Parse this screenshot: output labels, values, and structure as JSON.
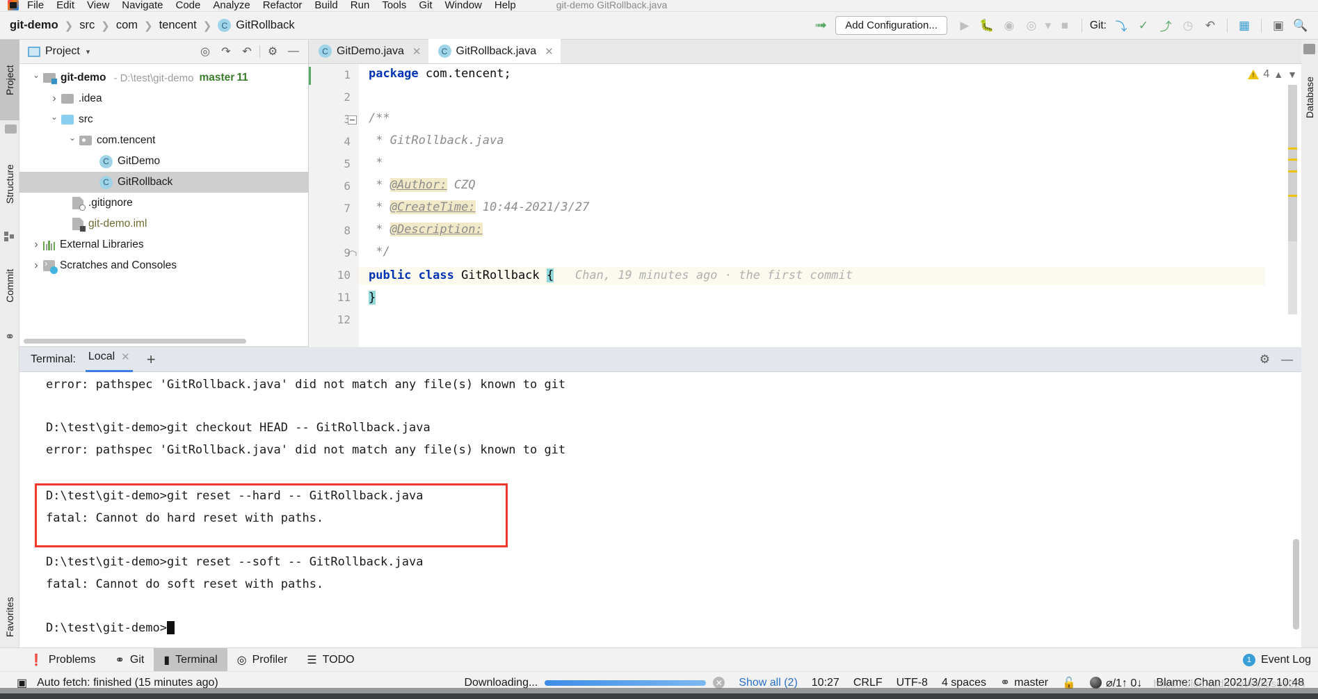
{
  "menubar": {
    "items": [
      "File",
      "Edit",
      "View",
      "Navigate",
      "Code",
      "Analyze",
      "Refactor",
      "Build",
      "Run",
      "Tools",
      "Git",
      "Window",
      "Help"
    ],
    "window_title": "git-demo    GitRollback.java"
  },
  "breadcrumb": [
    "git-demo",
    "src",
    "com",
    "tencent",
    "GitRollback"
  ],
  "toolbar": {
    "add_configuration": "Add Configuration...",
    "git_label": "Git:"
  },
  "left_strip": [
    "Project",
    "Structure",
    "Commit",
    "Favorites"
  ],
  "right_strip": [
    "Database"
  ],
  "project_panel": {
    "title": "Project",
    "tree": [
      {
        "label": "git-demo",
        "path": "- D:\\test\\git-demo",
        "branch": "master",
        "count": "11"
      },
      {
        "label": ".idea"
      },
      {
        "label": "src"
      },
      {
        "label": "com.tencent"
      },
      {
        "label": "GitDemo"
      },
      {
        "label": "GitRollback"
      },
      {
        "label": ".gitignore"
      },
      {
        "label": "git-demo.iml"
      },
      {
        "label": "External Libraries"
      },
      {
        "label": "Scratches and Consoles"
      }
    ]
  },
  "editor": {
    "tabs": [
      {
        "label": "GitDemo.java"
      },
      {
        "label": "GitRollback.java"
      }
    ],
    "line_numbers": [
      "1",
      "2",
      "3",
      "4",
      "5",
      "6",
      "7",
      "8",
      "9",
      "10",
      "11",
      "12"
    ],
    "inspection": {
      "count": "4"
    },
    "code": [
      "package com.tencent;",
      "",
      "/**",
      " * GitRollback.java",
      " *",
      " * @Author: CZQ",
      " * @CreateTime: 10:44-2021/3/27",
      " * @Description:",
      " */",
      "public class GitRollback {",
      "}",
      ""
    ],
    "inlay_hint": "Chan, 19 minutes ago · the first commit"
  },
  "terminal": {
    "label": "Terminal:",
    "tabs": [
      "Local"
    ],
    "lines": [
      "error: pathspec 'GitRollback.java' did not match any file(s) known to git",
      "D:\\test\\git-demo>git checkout HEAD -- GitRollback.java",
      "error: pathspec 'GitRollback.java' did not match any file(s) known to git",
      "D:\\test\\git-demo>git reset --hard -- GitRollback.java",
      "fatal: Cannot do hard reset with paths.",
      "D:\\test\\git-demo>git reset --soft -- GitRollback.java",
      "fatal: Cannot do soft reset with paths."
    ],
    "prompt": "D:\\test\\git-demo>"
  },
  "bottom_bar": {
    "items": [
      "Problems",
      "Git",
      "Terminal",
      "Profiler",
      "TODO"
    ],
    "event_log": "Event Log",
    "event_log_count": "1"
  },
  "status_bar": {
    "message": "Auto fetch: finished (15 minutes ago)",
    "task": "Downloading...",
    "show_all": "Show all (2)",
    "time": "10:27",
    "line_separator": "CRLF",
    "encoding": "UTF-8",
    "indent": "4 spaces",
    "branch": "master",
    "push_pull": "⌀/1↑ 0↓",
    "blame": "Blame: Chan 2021/3/27 10:48"
  },
  "watermark": "https://blog.csdn.net/eclipse1024"
}
